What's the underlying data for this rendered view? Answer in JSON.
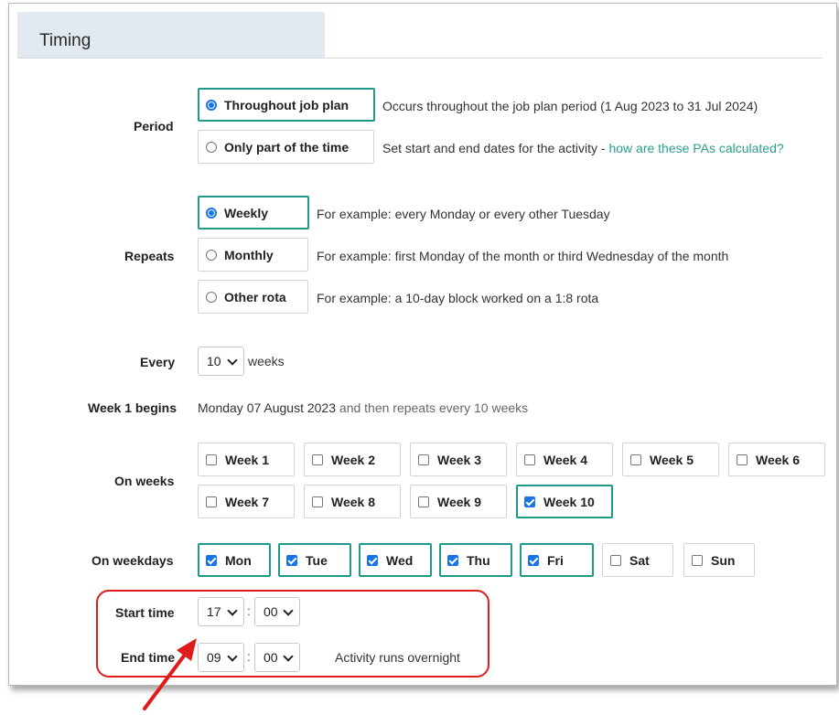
{
  "header": {
    "title": "Timing"
  },
  "period": {
    "label": "Period",
    "options": [
      {
        "label": "Throughout job plan",
        "desc": "Occurs throughout the job plan period (1 Aug 2023 to 31 Jul 2024)"
      },
      {
        "label": "Only part of the time",
        "desc": "Set start and end dates for the activity - ",
        "link": "how are these PAs calculated?"
      }
    ],
    "selected": "Throughout job plan"
  },
  "repeats": {
    "label": "Repeats",
    "options": [
      {
        "label": "Weekly",
        "desc": "For example: every Monday or every other Tuesday"
      },
      {
        "label": "Monthly",
        "desc": "For example: first Monday of the month or third Wednesday of the month"
      },
      {
        "label": "Other rota",
        "desc": "For example: a 10-day block worked on a 1:8 rota"
      }
    ],
    "selected": "Weekly"
  },
  "every": {
    "label": "Every",
    "value": "10",
    "unit": "weeks"
  },
  "week1": {
    "label": "Week 1 begins",
    "date": "Monday 07 August 2023",
    "suffix": " and then repeats every 10 weeks"
  },
  "on_weeks": {
    "label": "On weeks",
    "items": [
      "Week 1",
      "Week 2",
      "Week 3",
      "Week 4",
      "Week 5",
      "Week 6",
      "Week 7",
      "Week 8",
      "Week 9",
      "Week 10"
    ],
    "checked": [
      "Week 10"
    ]
  },
  "on_weekdays": {
    "label": "On weekdays",
    "items": [
      "Mon",
      "Tue",
      "Wed",
      "Thu",
      "Fri",
      "Sat",
      "Sun"
    ],
    "checked": [
      "Mon",
      "Tue",
      "Wed",
      "Thu",
      "Fri"
    ]
  },
  "start_time": {
    "label": "Start time",
    "hour": "17",
    "minute": "00"
  },
  "end_time": {
    "label": "End time",
    "hour": "09",
    "minute": "00",
    "note": "Activity runs overnight"
  },
  "colors": {
    "accent": "#1f9a8a",
    "checkbox": "#1a73e8",
    "highlight": "#e01b1b",
    "link": "#2a9d8f"
  },
  "time_separator": ":"
}
